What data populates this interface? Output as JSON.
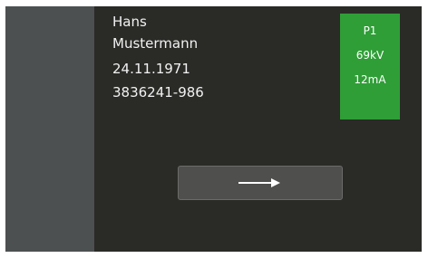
{
  "patient": {
    "first_name": "Hans",
    "last_name": "Mustermann",
    "birth_date": "24.11.1971",
    "patient_id": "3836241-986"
  },
  "exposure_params": {
    "program": "P1",
    "voltage": "69kV",
    "current": "12mA",
    "status_color": "#2f9e37"
  },
  "next_button": {
    "icon": "arrow-right-icon"
  }
}
